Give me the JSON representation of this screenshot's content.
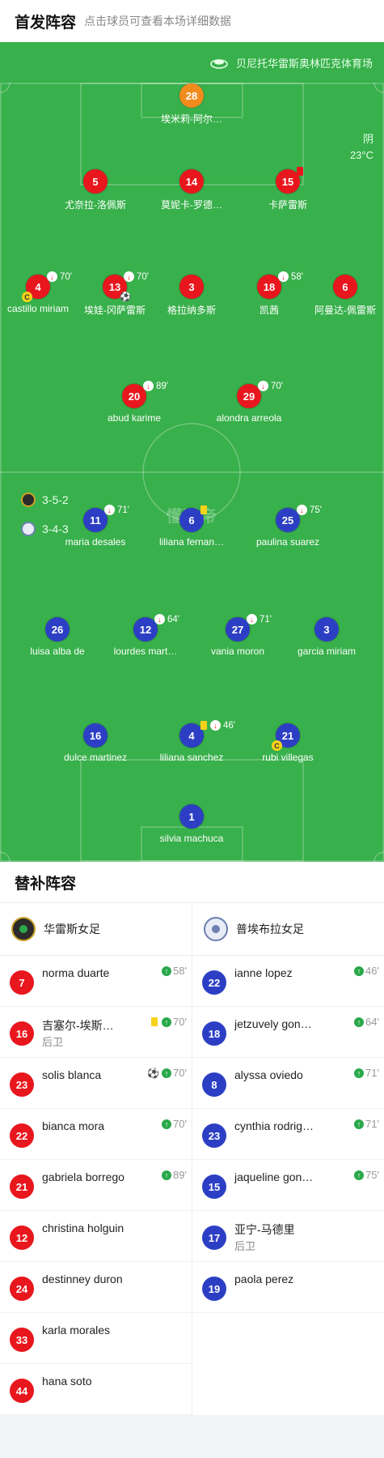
{
  "header": {
    "title": "首发阵容",
    "subtitle": "点击球员可查看本场详细数据"
  },
  "venue": {
    "name": "贝尼托华雷斯奥林匹克体育场",
    "icon": "stadium-icon"
  },
  "weather": {
    "condition": "阴",
    "temp": "23°C"
  },
  "watermark": "懂球帝",
  "formations": {
    "home": "3-5-2",
    "away": "3-4-3"
  },
  "home_lineup": [
    {
      "num": "28",
      "name": "埃米莉-阿尔…",
      "role": "gk"
    },
    {
      "num": "5",
      "name": "尤奈拉-洛佩斯"
    },
    {
      "num": "14",
      "name": "莫妮卡-罗德…"
    },
    {
      "num": "15",
      "name": "卡萨雷斯",
      "red": true
    },
    {
      "num": "4",
      "name": "castillo miriam",
      "sub": "70'",
      "captain": true
    },
    {
      "num": "13",
      "name": "埃娃-冈萨雷斯",
      "sub": "70'",
      "goal": true
    },
    {
      "num": "3",
      "name": "格拉纳多斯"
    },
    {
      "num": "18",
      "name": "凯茜",
      "sub": "58'"
    },
    {
      "num": "6",
      "name": "阿曼达-佩雷斯"
    },
    {
      "num": "20",
      "name": "abud karime",
      "sub": "89'"
    },
    {
      "num": "29",
      "name": "alondra arreola",
      "sub": "70'"
    }
  ],
  "away_lineup": [
    {
      "num": "11",
      "name": "maria desales",
      "sub": "71'"
    },
    {
      "num": "6",
      "name": "liliana fernan…",
      "yellow": true
    },
    {
      "num": "25",
      "name": "paulina suarez",
      "sub": "75'"
    },
    {
      "num": "26",
      "name": "luisa alba de"
    },
    {
      "num": "12",
      "name": "lourdes mart…",
      "sub": "64'"
    },
    {
      "num": "27",
      "name": "vania moron",
      "sub": "71'"
    },
    {
      "num": "3",
      "name": "garcia miriam"
    },
    {
      "num": "16",
      "name": "dulce martinez"
    },
    {
      "num": "4",
      "name": "liliana sanchez",
      "sub": "46'",
      "yellow": true
    },
    {
      "num": "21",
      "name": "rubi villegas",
      "captain": true
    },
    {
      "num": "1",
      "name": "silvia machuca"
    }
  ],
  "subs": {
    "title": "替补阵容",
    "home": {
      "team": "华雷斯女足",
      "players": [
        {
          "num": "7",
          "name": "norma duarte",
          "time": "58'"
        },
        {
          "num": "16",
          "name": "吉塞尔-埃斯…",
          "pos": "后卫",
          "time": "70'",
          "yellow": true
        },
        {
          "num": "23",
          "name": "solis blanca",
          "time": "70'",
          "goal": true
        },
        {
          "num": "22",
          "name": "bianca mora",
          "time": "70'"
        },
        {
          "num": "21",
          "name": "gabriela borrego",
          "time": "89'"
        },
        {
          "num": "12",
          "name": "christina holguin"
        },
        {
          "num": "24",
          "name": "destinney duron"
        },
        {
          "num": "33",
          "name": "karla morales"
        },
        {
          "num": "44",
          "name": "hana soto"
        }
      ]
    },
    "away": {
      "team": "普埃布拉女足",
      "players": [
        {
          "num": "22",
          "name": "ianne lopez",
          "time": "46'"
        },
        {
          "num": "18",
          "name": "jetzuvely gon…",
          "time": "64'"
        },
        {
          "num": "8",
          "name": "alyssa oviedo",
          "time": "71'"
        },
        {
          "num": "23",
          "name": "cynthia rodrig…",
          "time": "71'"
        },
        {
          "num": "15",
          "name": "jaqueline gon…",
          "time": "75'"
        },
        {
          "num": "17",
          "name": "亚宁-马德里",
          "pos": "后卫"
        },
        {
          "num": "19",
          "name": "paola perez"
        }
      ]
    }
  },
  "colors": {
    "pitch": "#38b04b",
    "home": "#e8161d",
    "away": "#2c3fc4",
    "gk": "#f28b1d"
  }
}
